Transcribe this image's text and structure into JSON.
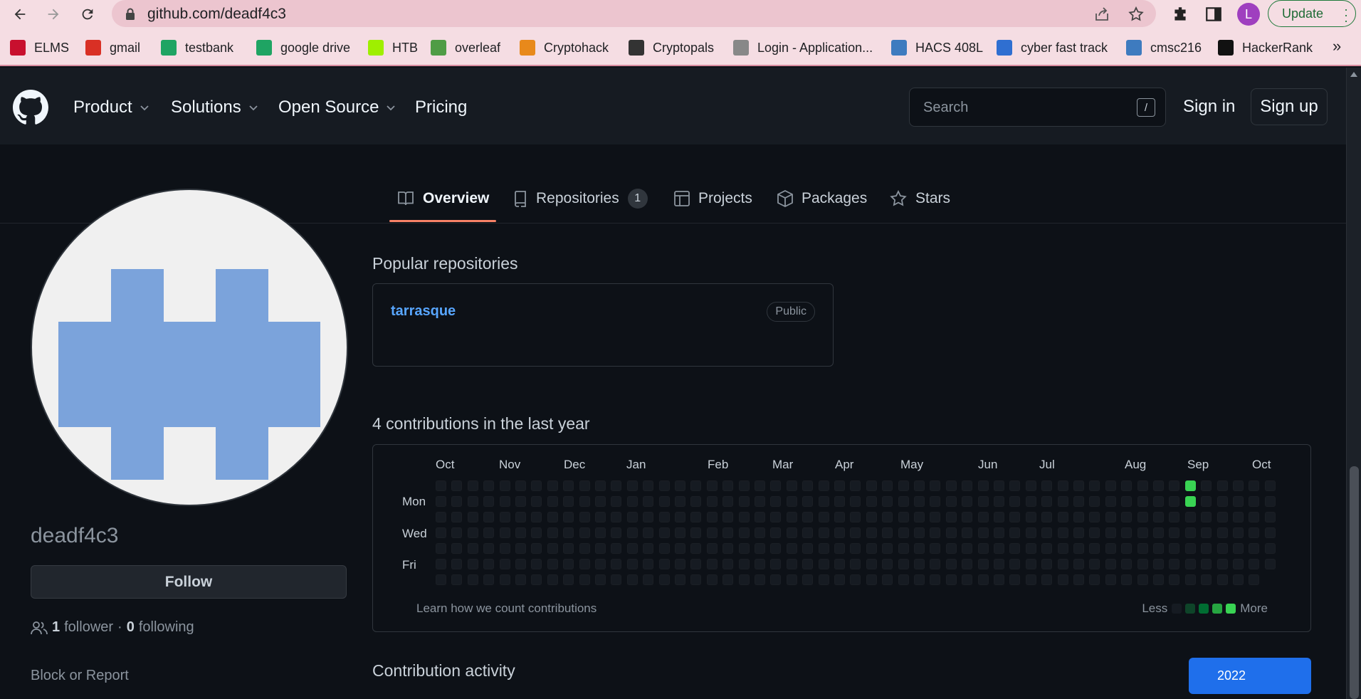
{
  "browser": {
    "url": "github.com/deadf4c3",
    "profile_initial": "L",
    "update_label": "Update",
    "bookmarks": [
      {
        "label": "ELMS",
        "icon": "elms-icon",
        "color": "#c8102e"
      },
      {
        "label": "gmail",
        "icon": "gmail-icon",
        "color": "#d93025"
      },
      {
        "label": "testbank",
        "icon": "google-drive-icon",
        "color": "#1fa463"
      },
      {
        "label": "google drive",
        "icon": "google-drive-icon",
        "color": "#1fa463"
      },
      {
        "label": "HTB",
        "icon": "htb-icon",
        "color": "#9fef00"
      },
      {
        "label": "overleaf",
        "icon": "overleaf-icon",
        "color": "#4f9c45"
      },
      {
        "label": "Cryptohack",
        "icon": "cryptohack-icon",
        "color": "#e8891b"
      },
      {
        "label": "Cryptopals",
        "icon": "cryptopals-icon",
        "color": "#333333"
      },
      {
        "label": "Login - Application...",
        "icon": "page-icon",
        "color": "#888888"
      },
      {
        "label": "HACS 408L",
        "icon": "piazza-icon",
        "color": "#3e7bbf"
      },
      {
        "label": "cyber fast track",
        "icon": "cs-icon",
        "color": "#2f6fd1"
      },
      {
        "label": "cmsc216",
        "icon": "piazza-icon",
        "color": "#3e7bbf"
      },
      {
        "label": "HackerRank",
        "icon": "hackerrank-icon",
        "color": "#111111"
      }
    ],
    "bookmarks_more": "»"
  },
  "header": {
    "nav": [
      {
        "label": "Product",
        "dropdown": true
      },
      {
        "label": "Solutions",
        "dropdown": true
      },
      {
        "label": "Open Source",
        "dropdown": true
      },
      {
        "label": "Pricing",
        "dropdown": false
      }
    ],
    "search_placeholder": "Search",
    "search_shortcut": "/",
    "sign_in": "Sign in",
    "sign_up": "Sign up"
  },
  "tabs": [
    {
      "label": "Overview",
      "icon": "book-icon",
      "active": true
    },
    {
      "label": "Repositories",
      "icon": "repo-icon",
      "count": "1"
    },
    {
      "label": "Projects",
      "icon": "table-icon"
    },
    {
      "label": "Packages",
      "icon": "package-icon"
    },
    {
      "label": "Stars",
      "icon": "star-icon"
    }
  ],
  "profile": {
    "username": "deadf4c3",
    "follow_label": "Follow",
    "followers_count": "1",
    "followers_label": "follower",
    "separator": "·",
    "following_count": "0",
    "following_label": "following",
    "block_label": "Block or Report",
    "avatar_color": "#7ba3db"
  },
  "popular": {
    "title": "Popular repositories",
    "repos": [
      {
        "name": "tarrasque",
        "visibility": "Public"
      }
    ]
  },
  "contributions": {
    "title": "4 contributions in the last year",
    "months": [
      "Oct",
      "Nov",
      "Dec",
      "Jan",
      "Feb",
      "Mar",
      "Apr",
      "May",
      "Jun",
      "Jul",
      "Aug",
      "Sep",
      "Oct"
    ],
    "days": [
      "Mon",
      "Wed",
      "Fri"
    ],
    "weeks": 53,
    "last_week_days": 6,
    "active_cells": [
      {
        "week": 47,
        "day": 0,
        "level": 4
      },
      {
        "week": 47,
        "day": 1,
        "level": 4
      }
    ],
    "learn_link": "Learn how we count contributions",
    "legend_less": "Less",
    "legend_more": "More",
    "colors": [
      "#161b22",
      "#0e4429",
      "#006d32",
      "#26a641",
      "#39d353"
    ]
  },
  "activity": {
    "title": "Contribution activity",
    "year": "2022"
  }
}
